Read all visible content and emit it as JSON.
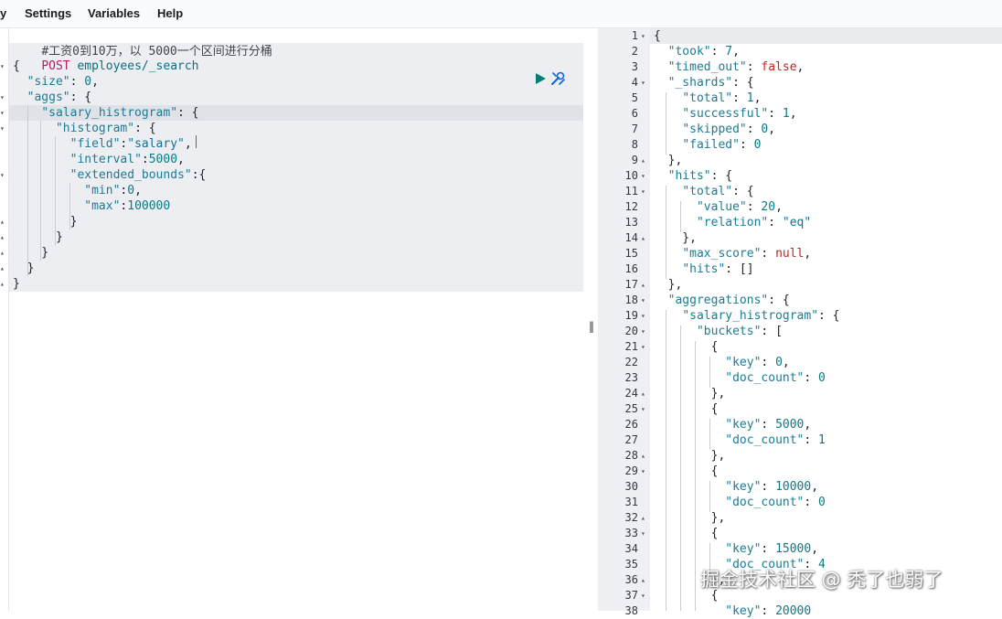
{
  "menu": {
    "history_label": "y",
    "settings_label": "Settings",
    "variables_label": "Variables",
    "help_label": "Help"
  },
  "request": {
    "comment": "#工资0到10万，以 5000一个区间进行分桶",
    "method": "POST",
    "path": "employees/_search",
    "body_lines": [
      [
        {
          "t": "{",
          "c": "punc"
        }
      ],
      [
        {
          "t": "  ",
          "c": "punc"
        },
        {
          "t": "\"size\"",
          "c": "key"
        },
        {
          "t": ": ",
          "c": "punc"
        },
        {
          "t": "0",
          "c": "num"
        },
        {
          "t": ",",
          "c": "punc"
        }
      ],
      [
        {
          "t": "  ",
          "c": "punc"
        },
        {
          "t": "\"aggs\"",
          "c": "key"
        },
        {
          "t": ": {",
          "c": "punc"
        }
      ],
      [
        {
          "t": "    ",
          "c": "punc"
        },
        {
          "t": "\"salary_histrogram\"",
          "c": "key"
        },
        {
          "t": ": {",
          "c": "punc"
        }
      ],
      [
        {
          "t": "      ",
          "c": "punc"
        },
        {
          "t": "\"histogram\"",
          "c": "key"
        },
        {
          "t": ": {",
          "c": "punc"
        }
      ],
      [
        {
          "t": "        ",
          "c": "punc"
        },
        {
          "t": "\"field\"",
          "c": "key"
        },
        {
          "t": ":",
          "c": "punc"
        },
        {
          "t": "\"salary\"",
          "c": "str"
        },
        {
          "t": ",",
          "c": "punc"
        }
      ],
      [
        {
          "t": "        ",
          "c": "punc"
        },
        {
          "t": "\"interval\"",
          "c": "key"
        },
        {
          "t": ":",
          "c": "punc"
        },
        {
          "t": "5000",
          "c": "num"
        },
        {
          "t": ",",
          "c": "punc"
        }
      ],
      [
        {
          "t": "        ",
          "c": "punc"
        },
        {
          "t": "\"extended_bounds\"",
          "c": "key"
        },
        {
          "t": ":{",
          "c": "punc"
        }
      ],
      [
        {
          "t": "          ",
          "c": "punc"
        },
        {
          "t": "\"min\"",
          "c": "key"
        },
        {
          "t": ":",
          "c": "punc"
        },
        {
          "t": "0",
          "c": "num"
        },
        {
          "t": ",",
          "c": "punc"
        }
      ],
      [
        {
          "t": "          ",
          "c": "punc"
        },
        {
          "t": "\"max\"",
          "c": "key"
        },
        {
          "t": ":",
          "c": "punc"
        },
        {
          "t": "100000",
          "c": "num"
        }
      ],
      [
        {
          "t": "        }",
          "c": "punc"
        }
      ],
      [
        {
          "t": "      }",
          "c": "punc"
        }
      ],
      [
        {
          "t": "    }",
          "c": "punc"
        }
      ],
      [
        {
          "t": "  }",
          "c": "punc"
        }
      ],
      [
        {
          "t": "}",
          "c": "punc"
        }
      ]
    ],
    "folds": [
      "▾",
      "",
      "▾",
      "▾",
      "▾",
      "",
      "",
      "▾",
      "",
      "",
      "▴",
      "▴",
      "▴",
      "▴",
      "▴"
    ]
  },
  "response": {
    "line_numbers": [
      "1",
      "2",
      "3",
      "4",
      "5",
      "6",
      "7",
      "8",
      "9",
      "10",
      "11",
      "12",
      "13",
      "14",
      "15",
      "16",
      "17",
      "18",
      "19",
      "20",
      "21",
      "22",
      "23",
      "24",
      "25",
      "26",
      "27",
      "28",
      "29",
      "30",
      "31",
      "32",
      "33",
      "34",
      "35",
      "36",
      "37",
      "38"
    ],
    "folds": [
      "▾",
      "",
      "",
      "▾",
      "",
      "",
      "",
      "",
      "▴",
      "▾",
      "▾",
      "",
      "",
      "▴",
      "",
      "",
      "▴",
      "▾",
      "▾",
      "▾",
      "▾",
      "",
      "",
      "▴",
      "▾",
      "",
      "",
      "▴",
      "▾",
      "",
      "",
      "▴",
      "▾",
      "",
      "",
      "▴",
      "▾",
      ""
    ],
    "lines": [
      [
        {
          "t": "{",
          "c": "punc"
        }
      ],
      [
        {
          "t": "  ",
          "c": "punc"
        },
        {
          "t": "\"took\"",
          "c": "key"
        },
        {
          "t": ": ",
          "c": "punc"
        },
        {
          "t": "7",
          "c": "num"
        },
        {
          "t": ",",
          "c": "punc"
        }
      ],
      [
        {
          "t": "  ",
          "c": "punc"
        },
        {
          "t": "\"timed_out\"",
          "c": "key"
        },
        {
          "t": ": ",
          "c": "punc"
        },
        {
          "t": "false",
          "c": "kw"
        },
        {
          "t": ",",
          "c": "punc"
        }
      ],
      [
        {
          "t": "  ",
          "c": "punc"
        },
        {
          "t": "\"_shards\"",
          "c": "key"
        },
        {
          "t": ": {",
          "c": "punc"
        }
      ],
      [
        {
          "t": "    ",
          "c": "punc"
        },
        {
          "t": "\"total\"",
          "c": "key"
        },
        {
          "t": ": ",
          "c": "punc"
        },
        {
          "t": "1",
          "c": "num"
        },
        {
          "t": ",",
          "c": "punc"
        }
      ],
      [
        {
          "t": "    ",
          "c": "punc"
        },
        {
          "t": "\"successful\"",
          "c": "key"
        },
        {
          "t": ": ",
          "c": "punc"
        },
        {
          "t": "1",
          "c": "num"
        },
        {
          "t": ",",
          "c": "punc"
        }
      ],
      [
        {
          "t": "    ",
          "c": "punc"
        },
        {
          "t": "\"skipped\"",
          "c": "key"
        },
        {
          "t": ": ",
          "c": "punc"
        },
        {
          "t": "0",
          "c": "num"
        },
        {
          "t": ",",
          "c": "punc"
        }
      ],
      [
        {
          "t": "    ",
          "c": "punc"
        },
        {
          "t": "\"failed\"",
          "c": "key"
        },
        {
          "t": ": ",
          "c": "punc"
        },
        {
          "t": "0",
          "c": "num"
        }
      ],
      [
        {
          "t": "  },",
          "c": "punc"
        }
      ],
      [
        {
          "t": "  ",
          "c": "punc"
        },
        {
          "t": "\"hits\"",
          "c": "key"
        },
        {
          "t": ": {",
          "c": "punc"
        }
      ],
      [
        {
          "t": "    ",
          "c": "punc"
        },
        {
          "t": "\"total\"",
          "c": "key"
        },
        {
          "t": ": {",
          "c": "punc"
        }
      ],
      [
        {
          "t": "      ",
          "c": "punc"
        },
        {
          "t": "\"value\"",
          "c": "key"
        },
        {
          "t": ": ",
          "c": "punc"
        },
        {
          "t": "20",
          "c": "num"
        },
        {
          "t": ",",
          "c": "punc"
        }
      ],
      [
        {
          "t": "      ",
          "c": "punc"
        },
        {
          "t": "\"relation\"",
          "c": "key"
        },
        {
          "t": ": ",
          "c": "punc"
        },
        {
          "t": "\"eq\"",
          "c": "str"
        }
      ],
      [
        {
          "t": "    },",
          "c": "punc"
        }
      ],
      [
        {
          "t": "    ",
          "c": "punc"
        },
        {
          "t": "\"max_score\"",
          "c": "key"
        },
        {
          "t": ": ",
          "c": "punc"
        },
        {
          "t": "null",
          "c": "kw"
        },
        {
          "t": ",",
          "c": "punc"
        }
      ],
      [
        {
          "t": "    ",
          "c": "punc"
        },
        {
          "t": "\"hits\"",
          "c": "key"
        },
        {
          "t": ": []",
          "c": "punc"
        }
      ],
      [
        {
          "t": "  },",
          "c": "punc"
        }
      ],
      [
        {
          "t": "  ",
          "c": "punc"
        },
        {
          "t": "\"aggregations\"",
          "c": "key"
        },
        {
          "t": ": {",
          "c": "punc"
        }
      ],
      [
        {
          "t": "    ",
          "c": "punc"
        },
        {
          "t": "\"salary_histrogram\"",
          "c": "key"
        },
        {
          "t": ": {",
          "c": "punc"
        }
      ],
      [
        {
          "t": "      ",
          "c": "punc"
        },
        {
          "t": "\"buckets\"",
          "c": "key"
        },
        {
          "t": ": [",
          "c": "punc"
        }
      ],
      [
        {
          "t": "        {",
          "c": "punc"
        }
      ],
      [
        {
          "t": "          ",
          "c": "punc"
        },
        {
          "t": "\"key\"",
          "c": "key"
        },
        {
          "t": ": ",
          "c": "punc"
        },
        {
          "t": "0",
          "c": "num"
        },
        {
          "t": ",",
          "c": "punc"
        }
      ],
      [
        {
          "t": "          ",
          "c": "punc"
        },
        {
          "t": "\"doc_count\"",
          "c": "key"
        },
        {
          "t": ": ",
          "c": "punc"
        },
        {
          "t": "0",
          "c": "num"
        }
      ],
      [
        {
          "t": "        },",
          "c": "punc"
        }
      ],
      [
        {
          "t": "        {",
          "c": "punc"
        }
      ],
      [
        {
          "t": "          ",
          "c": "punc"
        },
        {
          "t": "\"key\"",
          "c": "key"
        },
        {
          "t": ": ",
          "c": "punc"
        },
        {
          "t": "5000",
          "c": "num"
        },
        {
          "t": ",",
          "c": "punc"
        }
      ],
      [
        {
          "t": "          ",
          "c": "punc"
        },
        {
          "t": "\"doc_count\"",
          "c": "key"
        },
        {
          "t": ": ",
          "c": "punc"
        },
        {
          "t": "1",
          "c": "num"
        }
      ],
      [
        {
          "t": "        },",
          "c": "punc"
        }
      ],
      [
        {
          "t": "        {",
          "c": "punc"
        }
      ],
      [
        {
          "t": "          ",
          "c": "punc"
        },
        {
          "t": "\"key\"",
          "c": "key"
        },
        {
          "t": ": ",
          "c": "punc"
        },
        {
          "t": "10000",
          "c": "num"
        },
        {
          "t": ",",
          "c": "punc"
        }
      ],
      [
        {
          "t": "          ",
          "c": "punc"
        },
        {
          "t": "\"doc_count\"",
          "c": "key"
        },
        {
          "t": ": ",
          "c": "punc"
        },
        {
          "t": "0",
          "c": "num"
        }
      ],
      [
        {
          "t": "        },",
          "c": "punc"
        }
      ],
      [
        {
          "t": "        {",
          "c": "punc"
        }
      ],
      [
        {
          "t": "          ",
          "c": "punc"
        },
        {
          "t": "\"key\"",
          "c": "key"
        },
        {
          "t": ": ",
          "c": "punc"
        },
        {
          "t": "15000",
          "c": "num"
        },
        {
          "t": ",",
          "c": "punc"
        }
      ],
      [
        {
          "t": "          ",
          "c": "punc"
        },
        {
          "t": "\"doc_count\"",
          "c": "key"
        },
        {
          "t": ": ",
          "c": "punc"
        },
        {
          "t": "4",
          "c": "num"
        }
      ],
      [
        {
          "t": "        },",
          "c": "punc"
        }
      ],
      [
        {
          "t": "        {",
          "c": "punc"
        }
      ],
      [
        {
          "t": "          ",
          "c": "punc"
        },
        {
          "t": "\"key\"",
          "c": "key"
        },
        {
          "t": ": ",
          "c": "punc"
        },
        {
          "t": "20000",
          "c": "num"
        }
      ]
    ]
  },
  "icons": {
    "run": "play-icon",
    "settings": "wrench-icon",
    "divider": "resize-handle-icon"
  },
  "divider_glyph": "‖",
  "watermark": "掘金技术社区 @ 秃了也弱了",
  "colors": {
    "run_green": "#017d73",
    "wrench_blue": "#0b64dd",
    "editor_selection": "#eceef1",
    "key_teal": "#1d7b94",
    "keyword_red": "#bd271e"
  }
}
